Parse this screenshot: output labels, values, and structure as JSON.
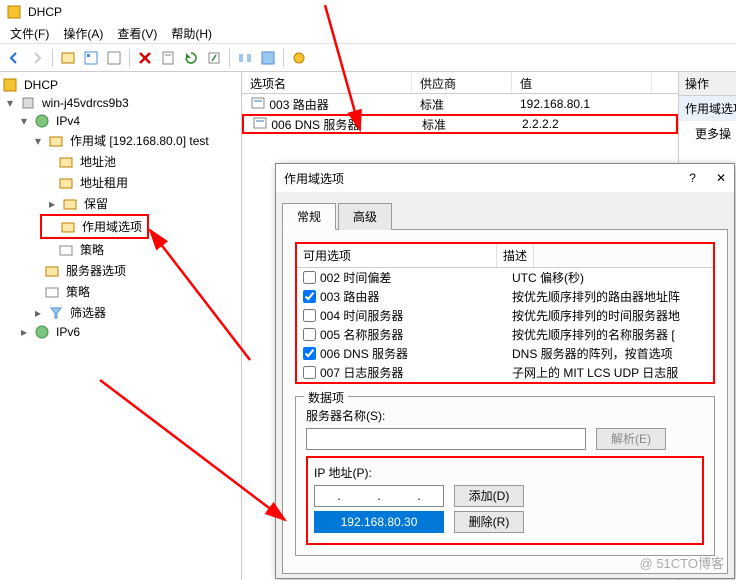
{
  "window": {
    "title": "DHCP"
  },
  "menubar": [
    "文件(F)",
    "操作(A)",
    "查看(V)",
    "帮助(H)"
  ],
  "tree": {
    "root": "DHCP",
    "server": "win-j45vdrcs9b3",
    "ipv4": "IPv4",
    "scope": "作用域 [192.168.80.0] test",
    "items": [
      "地址池",
      "地址租用",
      "保留",
      "作用域选项",
      "策略"
    ],
    "server_options": "服务器选项",
    "policies": "策略",
    "filters": "筛选器",
    "ipv6": "IPv6"
  },
  "list": {
    "columns": [
      "选项名",
      "供应商",
      "值"
    ],
    "rows": [
      {
        "name": "003 路由器",
        "vendor": "标准",
        "value": "192.168.80.1"
      },
      {
        "name": "006 DNS 服务器",
        "vendor": "标准",
        "value": "2.2.2.2"
      }
    ]
  },
  "right": {
    "header": "操作",
    "item1": "作用域选项",
    "item2": "更多操"
  },
  "dialog": {
    "title": "作用域选项",
    "tabs": [
      "常规",
      "高级"
    ],
    "options_header": [
      "可用选项",
      "描述"
    ],
    "options": [
      {
        "checked": false,
        "label": "002 时间偏差",
        "desc": "UTC 偏移(秒)"
      },
      {
        "checked": true,
        "label": "003 路由器",
        "desc": "按优先顺序排列的路由器地址阵"
      },
      {
        "checked": false,
        "label": "004 时间服务器",
        "desc": "按优先顺序排列的时间服务器地"
      },
      {
        "checked": false,
        "label": "005 名称服务器",
        "desc": "按优先顺序排列的名称服务器 ["
      },
      {
        "checked": true,
        "label": "006 DNS 服务器",
        "desc": "DNS 服务器的阵列，按首选项"
      },
      {
        "checked": false,
        "label": "007 日志服务器",
        "desc": "子网上的 MIT LCS UDP 日志服"
      }
    ],
    "data_group": "数据项",
    "server_name_label": "服务器名称(S):",
    "resolve_btn": "解析(E)",
    "ip_label": "IP 地址(P):",
    "ip_dots": "   .   .   .   ",
    "add_btn": "添加(D)",
    "ip_value": "192.168.80.30",
    "delete_btn": "删除(R)"
  },
  "watermark": "@ 51CTO博客"
}
